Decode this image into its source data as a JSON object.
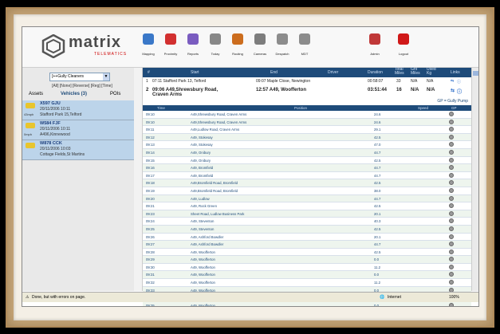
{
  "app": {
    "logo_text": "matrix",
    "logo_sub": "TELEMATICS"
  },
  "toolbar": {
    "items": [
      {
        "label": "Mapping",
        "icon": "globe-icon",
        "color": "#3a78c8"
      },
      {
        "label": "Proximity",
        "icon": "proximity-icon",
        "color": "#d23030"
      },
      {
        "label": "Reports",
        "icon": "reports-icon",
        "color": "#7a5cc0"
      },
      {
        "label": "Today",
        "icon": "clock-icon",
        "color": "#888888"
      },
      {
        "label": "Routing",
        "icon": "routing-icon",
        "color": "#cc6d1e"
      },
      {
        "label": "Cameras",
        "icon": "camera-icon",
        "color": "#7d7d7d"
      },
      {
        "label": "Despatch",
        "icon": "despatch-icon",
        "color": "#8c8c8c"
      },
      {
        "label": "MDT",
        "icon": "mdt-icon",
        "color": "#8c8c8c"
      },
      {
        "label": "Admin",
        "icon": "admin-icon",
        "color": "#c03838"
      },
      {
        "label": "Logout",
        "icon": "power-icon",
        "color": "#d01818"
      }
    ]
  },
  "left": {
    "group_select": "[++Gully Cleaners",
    "filters": "[All] [None] [Reverse] [Reg] [Time]",
    "tabs": {
      "assets": "Assets",
      "vehicles": "Vehicles (3)",
      "pois": "POIs"
    },
    "vehicles": [
      {
        "name": "X597 GJU",
        "datetime": "20/11/2006 10:11",
        "address": "Stafford Park 15,Telford",
        "speed": "43mph"
      },
      {
        "name": "W584 FJF",
        "datetime": "20/11/2006 10:11",
        "address": "A496,Kinnewood",
        "speed": "0mph"
      },
      {
        "name": "W878 CCK",
        "datetime": "20/11/2006 10:03",
        "address": "Cottage Fields,St Martins",
        "speed": ""
      }
    ]
  },
  "journeys": {
    "headers": {
      "num": "#",
      "start": "Start",
      "end": "End",
      "driver": "Driver",
      "duration": "Duration",
      "total": "Total Miles",
      "gnt": "Gnt Miles",
      "used": "Used Kg",
      "links": "Links"
    },
    "rows": [
      {
        "num": "1",
        "start": "07:11 Stafford Park 13, Telford",
        "end": "09:07 Maple Close, Newington",
        "duration": "00:58:07",
        "total": "33",
        "gnt": "N/A",
        "used": "N/A"
      },
      {
        "num": "2",
        "start": "09:06 A49,Shrewsbury Road, Craven Arms",
        "end": "12:57 A49, Woofferton",
        "duration": "03:51:44",
        "total": "16",
        "gnt": "N/A",
        "used": "N/A"
      }
    ],
    "gp_note": "GP = Gully Pump"
  },
  "detail": {
    "headers": {
      "time": "Time",
      "position": "Position",
      "speed": "Speed",
      "gp": "GP"
    },
    "rows": [
      {
        "time": "09:10",
        "position": "A49,Shrewsbury Road, Craven Arms",
        "speed": "24.6"
      },
      {
        "time": "09:10",
        "position": "A49,Shrewsbury Road, Craven Arms",
        "speed": "24.6"
      },
      {
        "time": "09:11",
        "position": "A49,Ludlow Road, Craven Arms",
        "speed": "29.1"
      },
      {
        "time": "09:12",
        "position": "A49, Stokesay",
        "speed": "42.5"
      },
      {
        "time": "09:13",
        "position": "A49, Stokesay",
        "speed": "47.0"
      },
      {
        "time": "09:14",
        "position": "A49, Onibury",
        "speed": "44.7"
      },
      {
        "time": "09:15",
        "position": "A49, Onibury",
        "speed": "42.5"
      },
      {
        "time": "09:16",
        "position": "A49, Bromfield",
        "speed": "44.7"
      },
      {
        "time": "09:17",
        "position": "A49, Bromfield",
        "speed": "44.7"
      },
      {
        "time": "09:18",
        "position": "A49,Bromfield Road, Bromfield",
        "speed": "42.5"
      },
      {
        "time": "09:19",
        "position": "A49,Bromfield Road, Bromfield",
        "speed": "38.0"
      },
      {
        "time": "09:20",
        "position": "A49, Ludlow",
        "speed": "44.7"
      },
      {
        "time": "09:21",
        "position": "A49, Rock Green",
        "speed": "42.5"
      },
      {
        "time": "09:23",
        "position": "Sheet Road, Ludlow Business Park",
        "speed": "20.1"
      },
      {
        "time": "09:24",
        "position": "A49, Steventon",
        "speed": "40.3"
      },
      {
        "time": "09:25",
        "position": "A49, Steventon",
        "speed": "42.5"
      },
      {
        "time": "09:26",
        "position": "A49, Ashford Bowdler",
        "speed": "20.1"
      },
      {
        "time": "09:27",
        "position": "A49, Ashford Bowdler",
        "speed": "44.7"
      },
      {
        "time": "09:28",
        "position": "A49, Woofferton",
        "speed": "42.5"
      },
      {
        "time": "09:29",
        "position": "A49, Woofferton",
        "speed": "0.0"
      },
      {
        "time": "09:30",
        "position": "A49, Woofferton",
        "speed": "11.2"
      },
      {
        "time": "09:31",
        "position": "A49, Woofferton",
        "speed": "0.0"
      },
      {
        "time": "09:32",
        "position": "A49, Woofferton",
        "speed": "11.2"
      },
      {
        "time": "09:33",
        "position": "A49, Woofferton",
        "speed": "0.0"
      },
      {
        "time": "09:34",
        "position": "A49, Woofferton",
        "speed": "0.0"
      },
      {
        "time": "09:35",
        "position": "A49, Woofferton",
        "speed": "0.0"
      }
    ]
  },
  "statusbar": {
    "left": "Done, but with errors on page.",
    "zone": "Internet",
    "zoom": "100%"
  }
}
